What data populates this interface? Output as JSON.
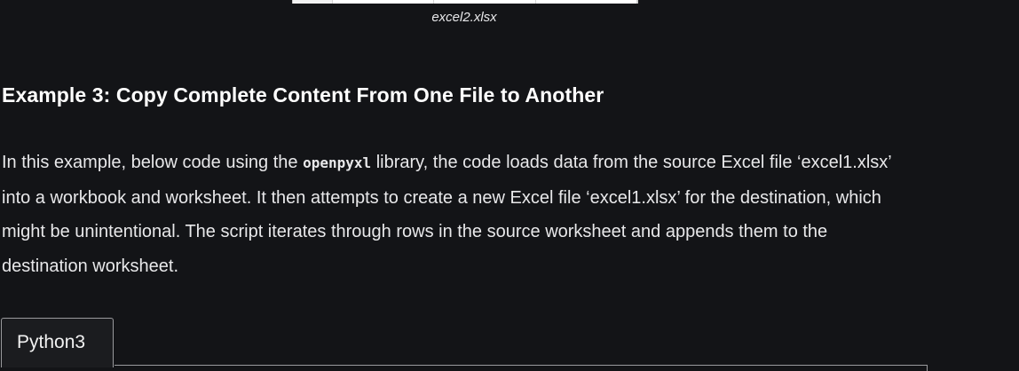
{
  "figure": {
    "caption": "excel2.xlsx"
  },
  "section": {
    "heading": "Example 3: Copy Complete Content From One File to Another",
    "paragraph": {
      "before_code": "In this example, below code using the ",
      "code": "openpyxl",
      "after_code": " library, the code loads data from the source Excel file ‘excel1.xlsx’ into a workbook and worksheet. It then attempts to create a new Excel file ‘excel1.xlsx’ for the destination, which might be unintentional. The script iterates through rows in the source worksheet and appends them to the destination worksheet."
    }
  },
  "code_block": {
    "tabs": [
      {
        "label": "Python3",
        "selected": true
      }
    ]
  }
}
